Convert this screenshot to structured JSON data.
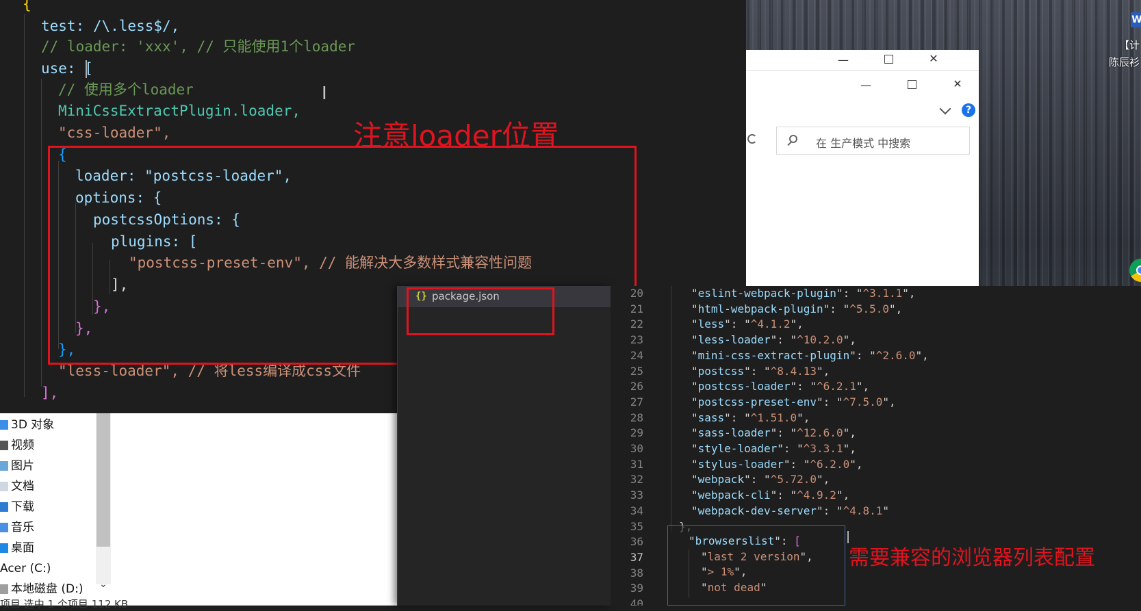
{
  "desktop": {
    "labels": [
      "【计",
      "陈辰衫"
    ],
    "word_icon": "W"
  },
  "explorer_window": {
    "search_placeholder": "在 生产模式 中搜索",
    "help": "?"
  },
  "editor": {
    "code_lines": [
      "{",
      "test: /\\.less$/,",
      "// loader: 'xxx', // 只能使用1个loader",
      "use: [",
      "// 使用多个loader",
      "MiniCssExtractPlugin.loader,",
      "\"css-loader\",",
      "{",
      "loader: \"postcss-loader\",",
      "options: {",
      "postcssOptions: {",
      "plugins: [",
      "\"postcss-preset-env\", // 能解决大多数样式兼容性问题",
      "],",
      "},",
      "},",
      "},",
      "\"less-loader\", // 将less编译成css文件",
      "],"
    ],
    "annotation_loader_position": "注意loader位置"
  },
  "file_nav": {
    "items": [
      "3D 对象",
      "视频",
      "图片",
      "文档",
      "下载",
      "音乐",
      "桌面",
      "Acer (C:)",
      "本地磁盘 (D:)"
    ],
    "status": "项目    选中 1 个项目  112 KB"
  },
  "vscode2": {
    "open_file": "package.json",
    "line_numbers": [
      "20",
      "21",
      "22",
      "23",
      "24",
      "25",
      "26",
      "27",
      "28",
      "29",
      "30",
      "31",
      "32",
      "33",
      "34",
      "35",
      "36",
      "37",
      "38",
      "39",
      "40"
    ],
    "active_line": "37",
    "dependencies": [
      {
        "name": "eslint-webpack-plugin",
        "version": "^3.1.1"
      },
      {
        "name": "html-webpack-plugin",
        "version": "^5.5.0"
      },
      {
        "name": "less",
        "version": "^4.1.2"
      },
      {
        "name": "less-loader",
        "version": "^10.2.0"
      },
      {
        "name": "mini-css-extract-plugin",
        "version": "^2.6.0"
      },
      {
        "name": "postcss",
        "version": "^8.4.13"
      },
      {
        "name": "postcss-loader",
        "version": "^6.2.1"
      },
      {
        "name": "postcss-preset-env",
        "version": "^7.5.0"
      },
      {
        "name": "sass",
        "version": "^1.51.0"
      },
      {
        "name": "sass-loader",
        "version": "^12.6.0"
      },
      {
        "name": "style-loader",
        "version": "^3.3.1"
      },
      {
        "name": "stylus-loader",
        "version": "^6.2.0"
      },
      {
        "name": "webpack",
        "version": "^5.72.0"
      },
      {
        "name": "webpack-cli",
        "version": "^4.9.2"
      },
      {
        "name": "webpack-dev-server",
        "version": "^4.8.1"
      }
    ],
    "close_brace": "},",
    "browserslist_key": "browserslist",
    "browserslist": [
      "last 2 version",
      "> 1%",
      "not dead"
    ],
    "annotation_browserslist": "需要兼容的浏览器列表配置"
  }
}
